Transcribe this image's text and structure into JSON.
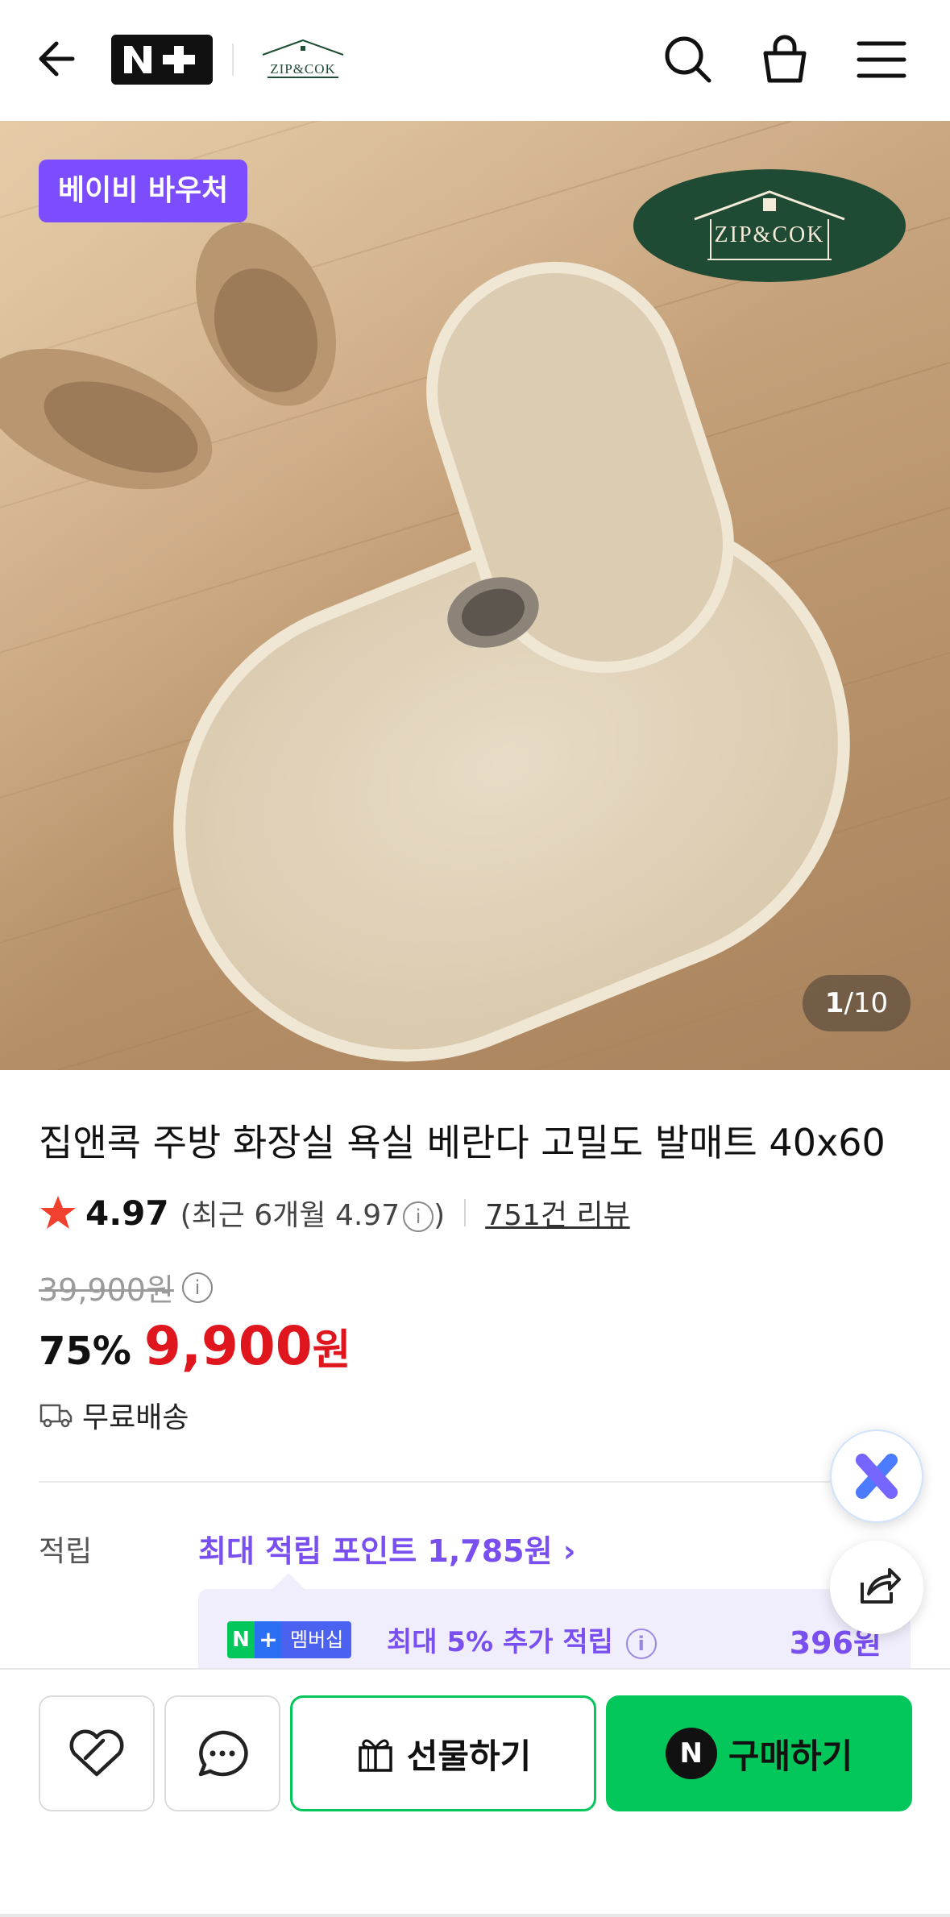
{
  "header": {
    "back_icon": "arrow-left-icon",
    "nplus_logo": "N+",
    "brand_logo": "ZIP&COK",
    "icons": [
      "search-icon",
      "shopping-bag-icon",
      "menu-icon"
    ]
  },
  "hero": {
    "voucher_badge": "베이비 바우처",
    "brand_mark": "ZIP&COK",
    "counter_current": "1",
    "counter_total": "/10"
  },
  "product": {
    "title": "집앤콕 주방 화장실 욕실 베란다 고밀도 발매트 40x60",
    "rating": "4.97",
    "recent_rating": "(최근 6개월 4.97",
    "recent_close": ")",
    "reviews": "751건 리뷰",
    "original_price": "39,900원",
    "discount": "75%",
    "price": "9,900",
    "price_unit": "원",
    "shipping": "무료배송"
  },
  "points": {
    "label": "적립",
    "max_points": "최대 적립 포인트 1,785원",
    "membership_n": "N",
    "membership_plus": "+",
    "membership_label": "멤버십",
    "extra": "최대 5% 추가 적립",
    "extra_amount": "396원"
  },
  "bottom": {
    "gift": "선물하기",
    "buy_badge": "N",
    "buy": "구매하기"
  },
  "colors": {
    "accent_purple": "#7b4dff",
    "price_red": "#e0161f",
    "naver_green": "#03c75a"
  }
}
